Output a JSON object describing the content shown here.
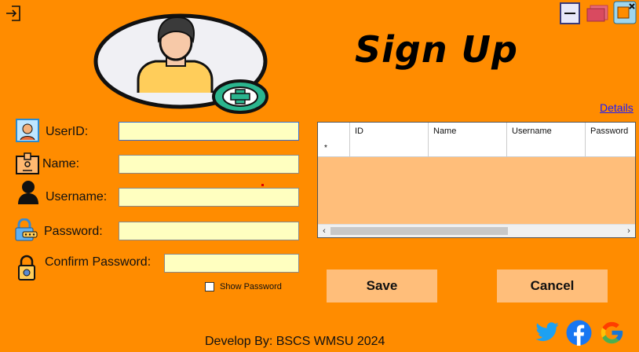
{
  "title": "Sign Up",
  "details_link": "Details",
  "fields": {
    "userid_label": "UserID:",
    "name_label": "Name:",
    "username_label": "Username:",
    "password_label": "Password:",
    "confirm_label": "Confirm Password:",
    "show_password_label": "Show Password"
  },
  "grid": {
    "row_marker": "*",
    "columns": [
      "ID",
      "Name",
      "Username",
      "Password"
    ]
  },
  "buttons": {
    "save": "Save",
    "cancel": "Cancel"
  },
  "footer": "Develop By: BSCS WMSU 2024",
  "colors": {
    "background": "#FF8C00",
    "input": "#FFFFC0",
    "button": "#FFBE7A"
  }
}
